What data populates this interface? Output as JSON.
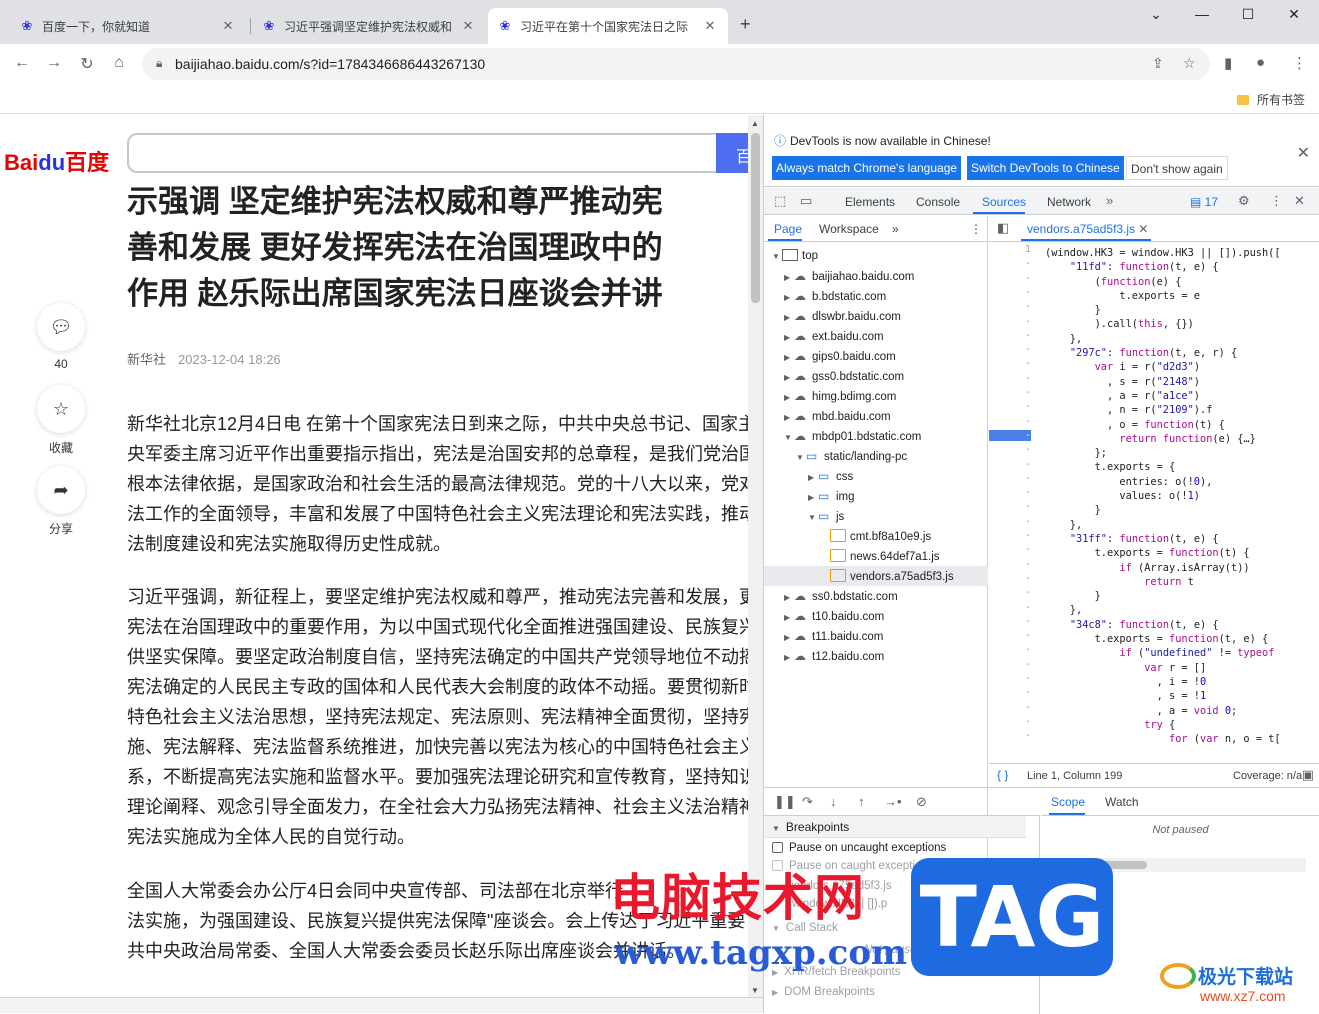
{
  "tabs": [
    {
      "title": "百度一下，你就知道",
      "favicon": "baidu-paw-icon",
      "active": false
    },
    {
      "title": "习近平强调坚定维护宪法权威和",
      "favicon": "baidu-paw-icon",
      "active": false
    },
    {
      "title": "习近平在第十个国家宪法日之际",
      "favicon": "baidu-paw-icon",
      "active": true
    }
  ],
  "omnibox": {
    "url": "baijiahao.baidu.com/s?id=1784346686443267130"
  },
  "bookmarks": {
    "all_bookmarks": "所有书签"
  },
  "page": {
    "logo_bai": "Bai",
    "logo_du": "du",
    "logo_cn": "百度",
    "search_btn": "百",
    "headline": [
      "示强调 坚定维护宪法权威和尊严推动宪",
      "善和发展 更好发挥宪法在治国理政中的",
      "作用 赵乐际出席国家宪法日座谈会并讲"
    ],
    "side": {
      "comment_count": "40",
      "favorite": "收藏",
      "share": "分享"
    },
    "source": "新华社",
    "time": "2023-12-04 18:26",
    "paragraphs": [
      [
        "新华社北京12月4日电 在第十个国家宪法日到来之际，中共中央总书记、国家主",
        "央军委主席习近平作出重要指示指出，宪法是治国安邦的总章程，是我们党治国",
        "根本法律依据，是国家政治和社会生活的最高法律规范。党的十八大以来，党对",
        "法工作的全面领导，丰富和发展了中国特色社会主义宪法理论和宪法实践，推动",
        "法制度建设和宪法实施取得历史性成就。"
      ],
      [
        "习近平强调，新征程上，要坚定维护宪法权威和尊严，推动宪法完善和发展，更",
        "宪法在治国理政中的重要作用，为以中国式现代化全面推进强国建设、民族复兴",
        "供坚实保障。要坚定政治制度自信，坚持宪法确定的中国共产党领导地位不动摇",
        "宪法确定的人民民主专政的国体和人民代表大会制度的政体不动摇。要贯彻新时",
        "特色社会主义法治思想，坚持宪法规定、宪法原则、宪法精神全面贯彻，坚持宪",
        "施、宪法解释、宪法监督系统推进，加快完善以宪法为核心的中国特色社会主义",
        "系，不断提高宪法实施和监督水平。要加强宪法理论研究和宣传教育，坚持知识",
        "理论阐释、观念引导全面发力，在全社会大力弘扬宪法精神、社会主义法治精神",
        "宪法实施成为全体人民的自觉行动。"
      ],
      [
        "全国人大常委会办公厅4日会同中央宣传部、司法部在北京举行",
        "法实施，为强国建设、民族复兴提供宪法保障\"座谈会。会上传达了习近平重要",
        "共中央政治局常委、全国人大常委会委员长赵乐际出席座谈会并讲话。"
      ]
    ]
  },
  "devtools": {
    "infobar": {
      "message": "DevTools is now available in Chinese!",
      "btn_match": "Always match Chrome's language",
      "btn_switch": "Switch DevTools to Chinese",
      "btn_dont": "Don't show again"
    },
    "main_tabs": [
      "Elements",
      "Console",
      "Sources",
      "Network"
    ],
    "active_main_tab": "Sources",
    "issues_count": "17",
    "nav_tabs": [
      "Page",
      "Workspace"
    ],
    "tree": [
      {
        "label": "top",
        "type": "frame",
        "depth": 0,
        "expanded": true
      },
      {
        "label": "baijiahao.baidu.com",
        "type": "cloud",
        "depth": 1
      },
      {
        "label": "b.bdstatic.com",
        "type": "cloud",
        "depth": 1
      },
      {
        "label": "dlswbr.baidu.com",
        "type": "cloud",
        "depth": 1
      },
      {
        "label": "ext.baidu.com",
        "type": "cloud",
        "depth": 1
      },
      {
        "label": "gips0.baidu.com",
        "type": "cloud",
        "depth": 1
      },
      {
        "label": "gss0.bdstatic.com",
        "type": "cloud",
        "depth": 1
      },
      {
        "label": "himg.bdimg.com",
        "type": "cloud",
        "depth": 1
      },
      {
        "label": "mbd.baidu.com",
        "type": "cloud",
        "depth": 1
      },
      {
        "label": "mbdp01.bdstatic.com",
        "type": "cloud",
        "depth": 1,
        "expanded": true
      },
      {
        "label": "static/landing-pc",
        "type": "folder",
        "depth": 2,
        "expanded": true
      },
      {
        "label": "css",
        "type": "folder",
        "depth": 3
      },
      {
        "label": "img",
        "type": "folder",
        "depth": 3
      },
      {
        "label": "js",
        "type": "folder",
        "depth": 3,
        "expanded": true
      },
      {
        "label": "cmt.bf8a10e9.js",
        "type": "file",
        "depth": 4
      },
      {
        "label": "news.64def7a1.js",
        "type": "file",
        "depth": 4
      },
      {
        "label": "vendors.a75ad5f3.js",
        "type": "file",
        "depth": 4,
        "selected": true
      },
      {
        "label": "ss0.bdstatic.com",
        "type": "cloud",
        "depth": 1
      },
      {
        "label": "t10.baidu.com",
        "type": "cloud",
        "depth": 1
      },
      {
        "label": "t11.baidu.com",
        "type": "cloud",
        "depth": 1
      },
      {
        "label": "t12.baidu.com",
        "type": "cloud",
        "depth": 1
      }
    ],
    "editor_file": "vendors.a75ad5f3.js",
    "gutter_first": "1",
    "gutter_dash": "-",
    "status": {
      "position": "Line 1, Column 199",
      "coverage": "Coverage: n/a"
    },
    "breakpoints_title": "Breakpoints",
    "pause_uncaught": "Pause on uncaught exceptions",
    "pause_caught": "Pause on caught exceptions",
    "bp_file": "vendors.a75ad5f3.js",
    "bp_code": "(window.HK3 || []).p",
    "call_stack": "Call Stack",
    "not_paused_small": "Not paused",
    "xhr": "XHR/fetch Breakpoints",
    "dom": "DOM Breakpoints",
    "right_tabs": [
      "Scope",
      "Watch"
    ],
    "not_paused": "Not paused"
  },
  "watermark": {
    "site_cn": "电脑技术网",
    "site_url": "www.tagxp.com",
    "tag": "TAG",
    "jg_name": "极光下载站",
    "jg_url": "www.xz7.com"
  }
}
